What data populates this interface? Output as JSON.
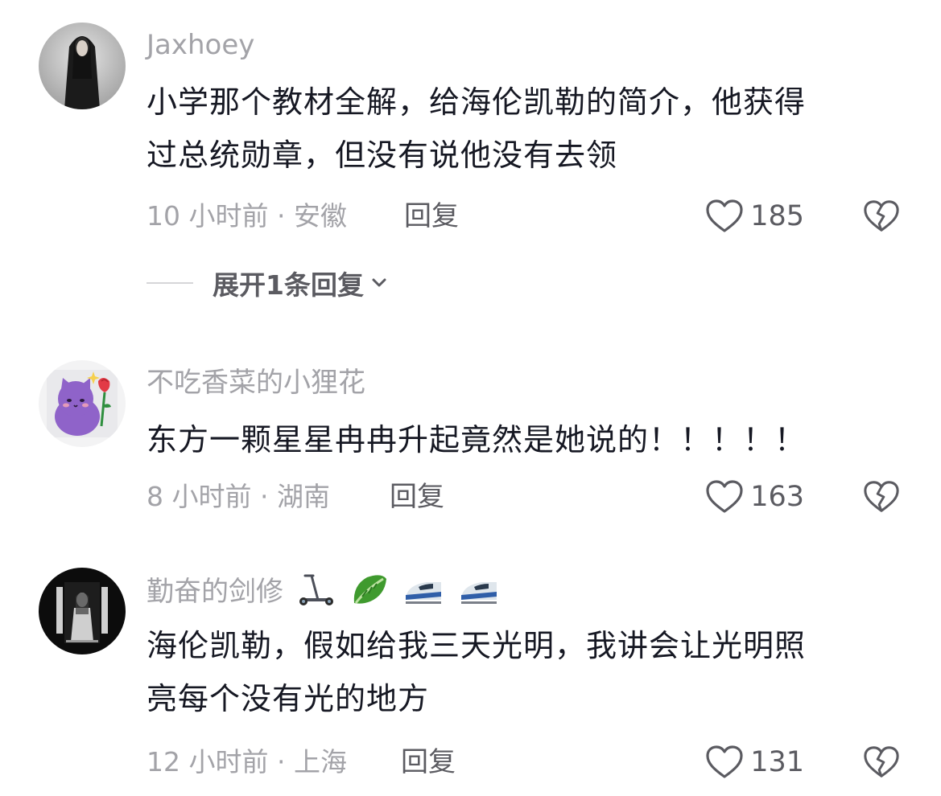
{
  "comments": [
    {
      "username": "Jaxhoey",
      "text_lines": [
        "小学那个教材全解，给海伦凯勒的简介，他获得",
        "过总统勋章，但没有说他没有去领"
      ],
      "time": "10 小时前",
      "location": "安徽",
      "reply_label": "回复",
      "likes": "185",
      "expand_label": "展开1条回复",
      "avatar_icon": "dark-robed-figure-avatar"
    },
    {
      "username": "不吃香菜的小狸花",
      "text_lines": [
        "东方一颗星星冉冉升起竟然是她说的！！！！！"
      ],
      "time": "8 小时前",
      "location": "湖南",
      "reply_label": "回复",
      "likes": "163",
      "avatar_icon": "purple-cat-with-rose-avatar"
    },
    {
      "username": "勤奋的剑修",
      "username_emojis": [
        "scooter-emoji",
        "leafy-green-emoji",
        "bullet-train-emoji",
        "bullet-train-emoji"
      ],
      "text_lines": [
        "海伦凯勒，假如给我三天光明，我讲会让光明照",
        "亮每个没有光的地方"
      ],
      "time": "12 小时前",
      "location": "上海",
      "reply_label": "回复",
      "likes": "131",
      "avatar_icon": "dark-window-figure-avatar"
    }
  ],
  "separator": " · ",
  "colors": {
    "text": "#161823",
    "secondary": "#a3a3a8",
    "action": "#5b5b61"
  }
}
